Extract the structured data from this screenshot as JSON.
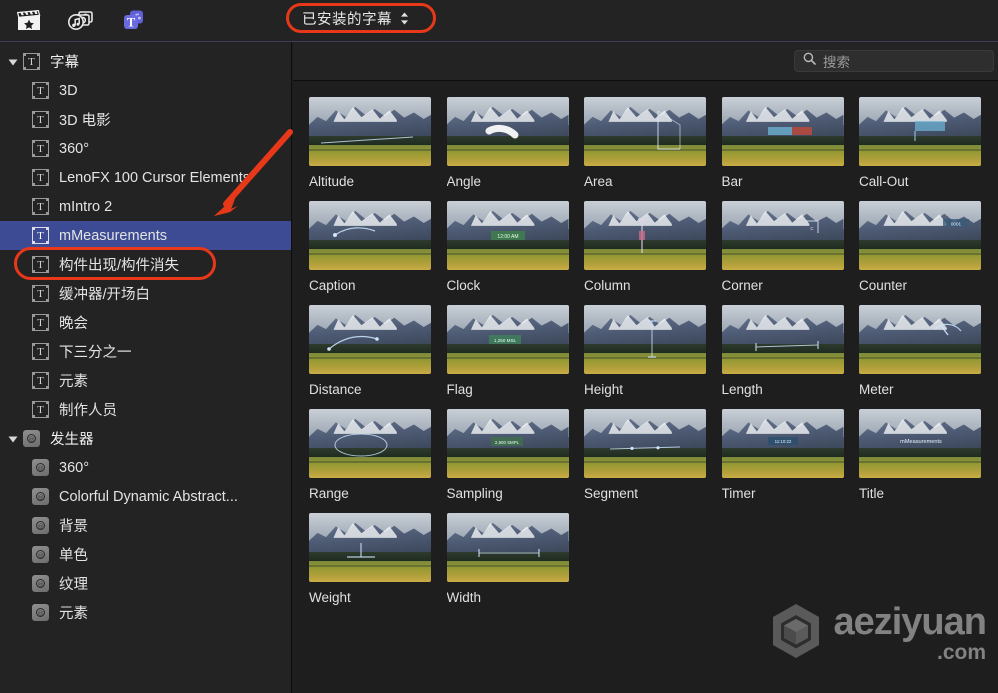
{
  "toolbar": {
    "icons": [
      {
        "name": "media-browser-icon",
        "glyph": "clapperboard",
        "active": false
      },
      {
        "name": "photos-audio-icon",
        "glyph": "photos-audio",
        "active": false
      },
      {
        "name": "titles-generators-icon",
        "glyph": "titles",
        "active": true
      }
    ],
    "dropdown": {
      "value": "已安装的字幕",
      "highlight_color": "#e8381a"
    }
  },
  "sidebar": {
    "groups": [
      {
        "name": "titles",
        "label": "字幕",
        "icon": "title-icon",
        "expanded": true,
        "items": [
          {
            "label": "3D",
            "icon": "title-icon",
            "selected": false
          },
          {
            "label": "3D 电影",
            "icon": "title-icon",
            "selected": false
          },
          {
            "label": "360°",
            "icon": "title-icon",
            "selected": false
          },
          {
            "label": "LenoFX 100 Cursor Elements",
            "icon": "title-icon",
            "selected": false
          },
          {
            "label": "mIntro 2",
            "icon": "title-icon",
            "selected": false
          },
          {
            "label": "mMeasurements",
            "icon": "title-icon",
            "selected": true
          },
          {
            "label": "构件出现/构件消失",
            "icon": "title-icon",
            "selected": false
          },
          {
            "label": "缓冲器/开场白",
            "icon": "title-icon",
            "selected": false
          },
          {
            "label": "晚会",
            "icon": "title-icon",
            "selected": false
          },
          {
            "label": "下三分之一",
            "icon": "title-icon",
            "selected": false
          },
          {
            "label": "元素",
            "icon": "title-icon",
            "selected": false
          },
          {
            "label": "制作人员",
            "icon": "title-icon",
            "selected": false
          }
        ]
      },
      {
        "name": "generators",
        "label": "发生器",
        "icon": "generator-icon",
        "expanded": true,
        "items": [
          {
            "label": "360°",
            "icon": "generator-icon",
            "selected": false
          },
          {
            "label": "Colorful Dynamic Abstract...",
            "icon": "generator-icon",
            "selected": false
          },
          {
            "label": "背景",
            "icon": "generator-icon",
            "selected": false
          },
          {
            "label": "单色",
            "icon": "generator-icon",
            "selected": false
          },
          {
            "label": "纹理",
            "icon": "generator-icon",
            "selected": false
          },
          {
            "label": "元素",
            "icon": "generator-icon",
            "selected": false
          }
        ]
      }
    ],
    "selection_color": "#3c4b93"
  },
  "search": {
    "placeholder": "搜索",
    "icon": "search-icon",
    "value": ""
  },
  "browser": {
    "items": [
      {
        "label": "Altitude",
        "overlay": "altitude"
      },
      {
        "label": "Angle",
        "overlay": "angle"
      },
      {
        "label": "Area",
        "overlay": "area"
      },
      {
        "label": "Bar",
        "overlay": "bar"
      },
      {
        "label": "Call-Out",
        "overlay": "callout"
      },
      {
        "label": "Caption",
        "overlay": "caption"
      },
      {
        "label": "Clock",
        "overlay": "clock"
      },
      {
        "label": "Column",
        "overlay": "column"
      },
      {
        "label": "Corner",
        "overlay": "corner"
      },
      {
        "label": "Counter",
        "overlay": "counter"
      },
      {
        "label": "Distance",
        "overlay": "distance"
      },
      {
        "label": "Flag",
        "overlay": "flag"
      },
      {
        "label": "Height",
        "overlay": "height"
      },
      {
        "label": "Length",
        "overlay": "length"
      },
      {
        "label": "Meter",
        "overlay": "meter"
      },
      {
        "label": "Range",
        "overlay": "range"
      },
      {
        "label": "Sampling",
        "overlay": "sampling"
      },
      {
        "label": "Segment",
        "overlay": "segment"
      },
      {
        "label": "Timer",
        "overlay": "timer"
      },
      {
        "label": "Title",
        "overlay": "title"
      },
      {
        "label": "Weight",
        "overlay": "weight"
      },
      {
        "label": "Width",
        "overlay": "width"
      }
    ]
  },
  "annotations": {
    "arrow_color": "#e8381a",
    "oval_color": "#e8381a"
  },
  "watermark": {
    "main": "aeziyuan",
    "sub": ".com",
    "logo": "cube-logo"
  }
}
